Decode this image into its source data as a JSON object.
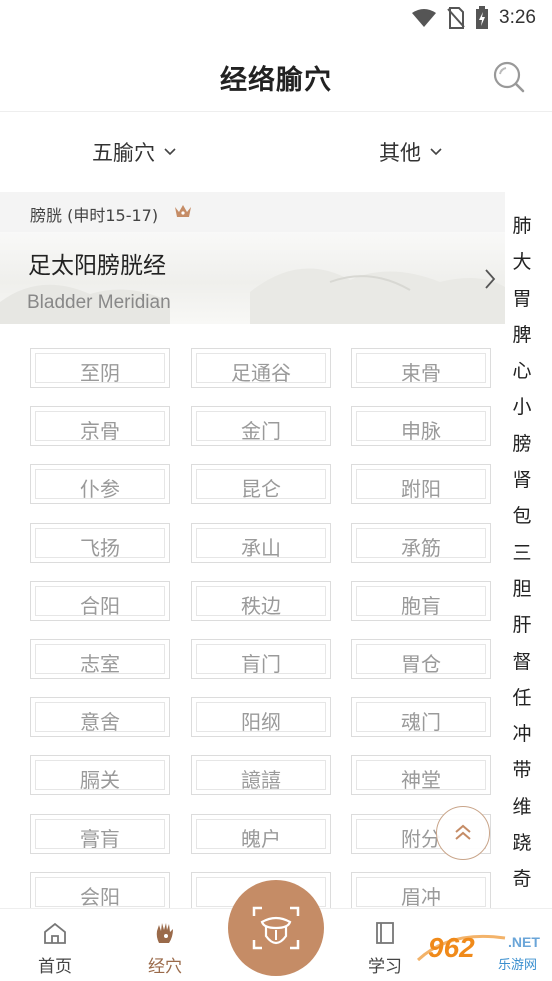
{
  "status_bar": {
    "time": "3:26"
  },
  "header": {
    "title": "经络腧穴"
  },
  "filters": {
    "left_label": "五腧穴",
    "right_label": "其他"
  },
  "section": {
    "label": "膀胱 (申时15-17)"
  },
  "meridian": {
    "name": "足太阳膀胱经",
    "english": "Bladder Meridian"
  },
  "points": [
    "至阴",
    "足通谷",
    "束骨",
    "京骨",
    "金门",
    "申脉",
    "仆参",
    "昆仑",
    "跗阳",
    "飞扬",
    "承山",
    "承筋",
    "合阳",
    "秩边",
    "胞肓",
    "志室",
    "肓门",
    "胃仓",
    "意舍",
    "阳纲",
    "魂门",
    "膈关",
    "譩譆",
    "神堂",
    "膏肓",
    "魄户",
    "附分",
    "会阳",
    "",
    "眉冲"
  ],
  "index_bar": [
    "肺",
    "大",
    "胃",
    "脾",
    "心",
    "小",
    "膀",
    "肾",
    "包",
    "三",
    "胆",
    "肝",
    "督",
    "任",
    "冲",
    "带",
    "维",
    "跷",
    "奇"
  ],
  "bottom_nav": {
    "home_label": "首页",
    "points_label": "经穴",
    "study_label": "学习"
  },
  "colors": {
    "accent": "#c58c66",
    "active_text": "#9a6a4a"
  },
  "watermark": {
    "brand": "962",
    "net": ".NET",
    "sub": "乐游网"
  }
}
